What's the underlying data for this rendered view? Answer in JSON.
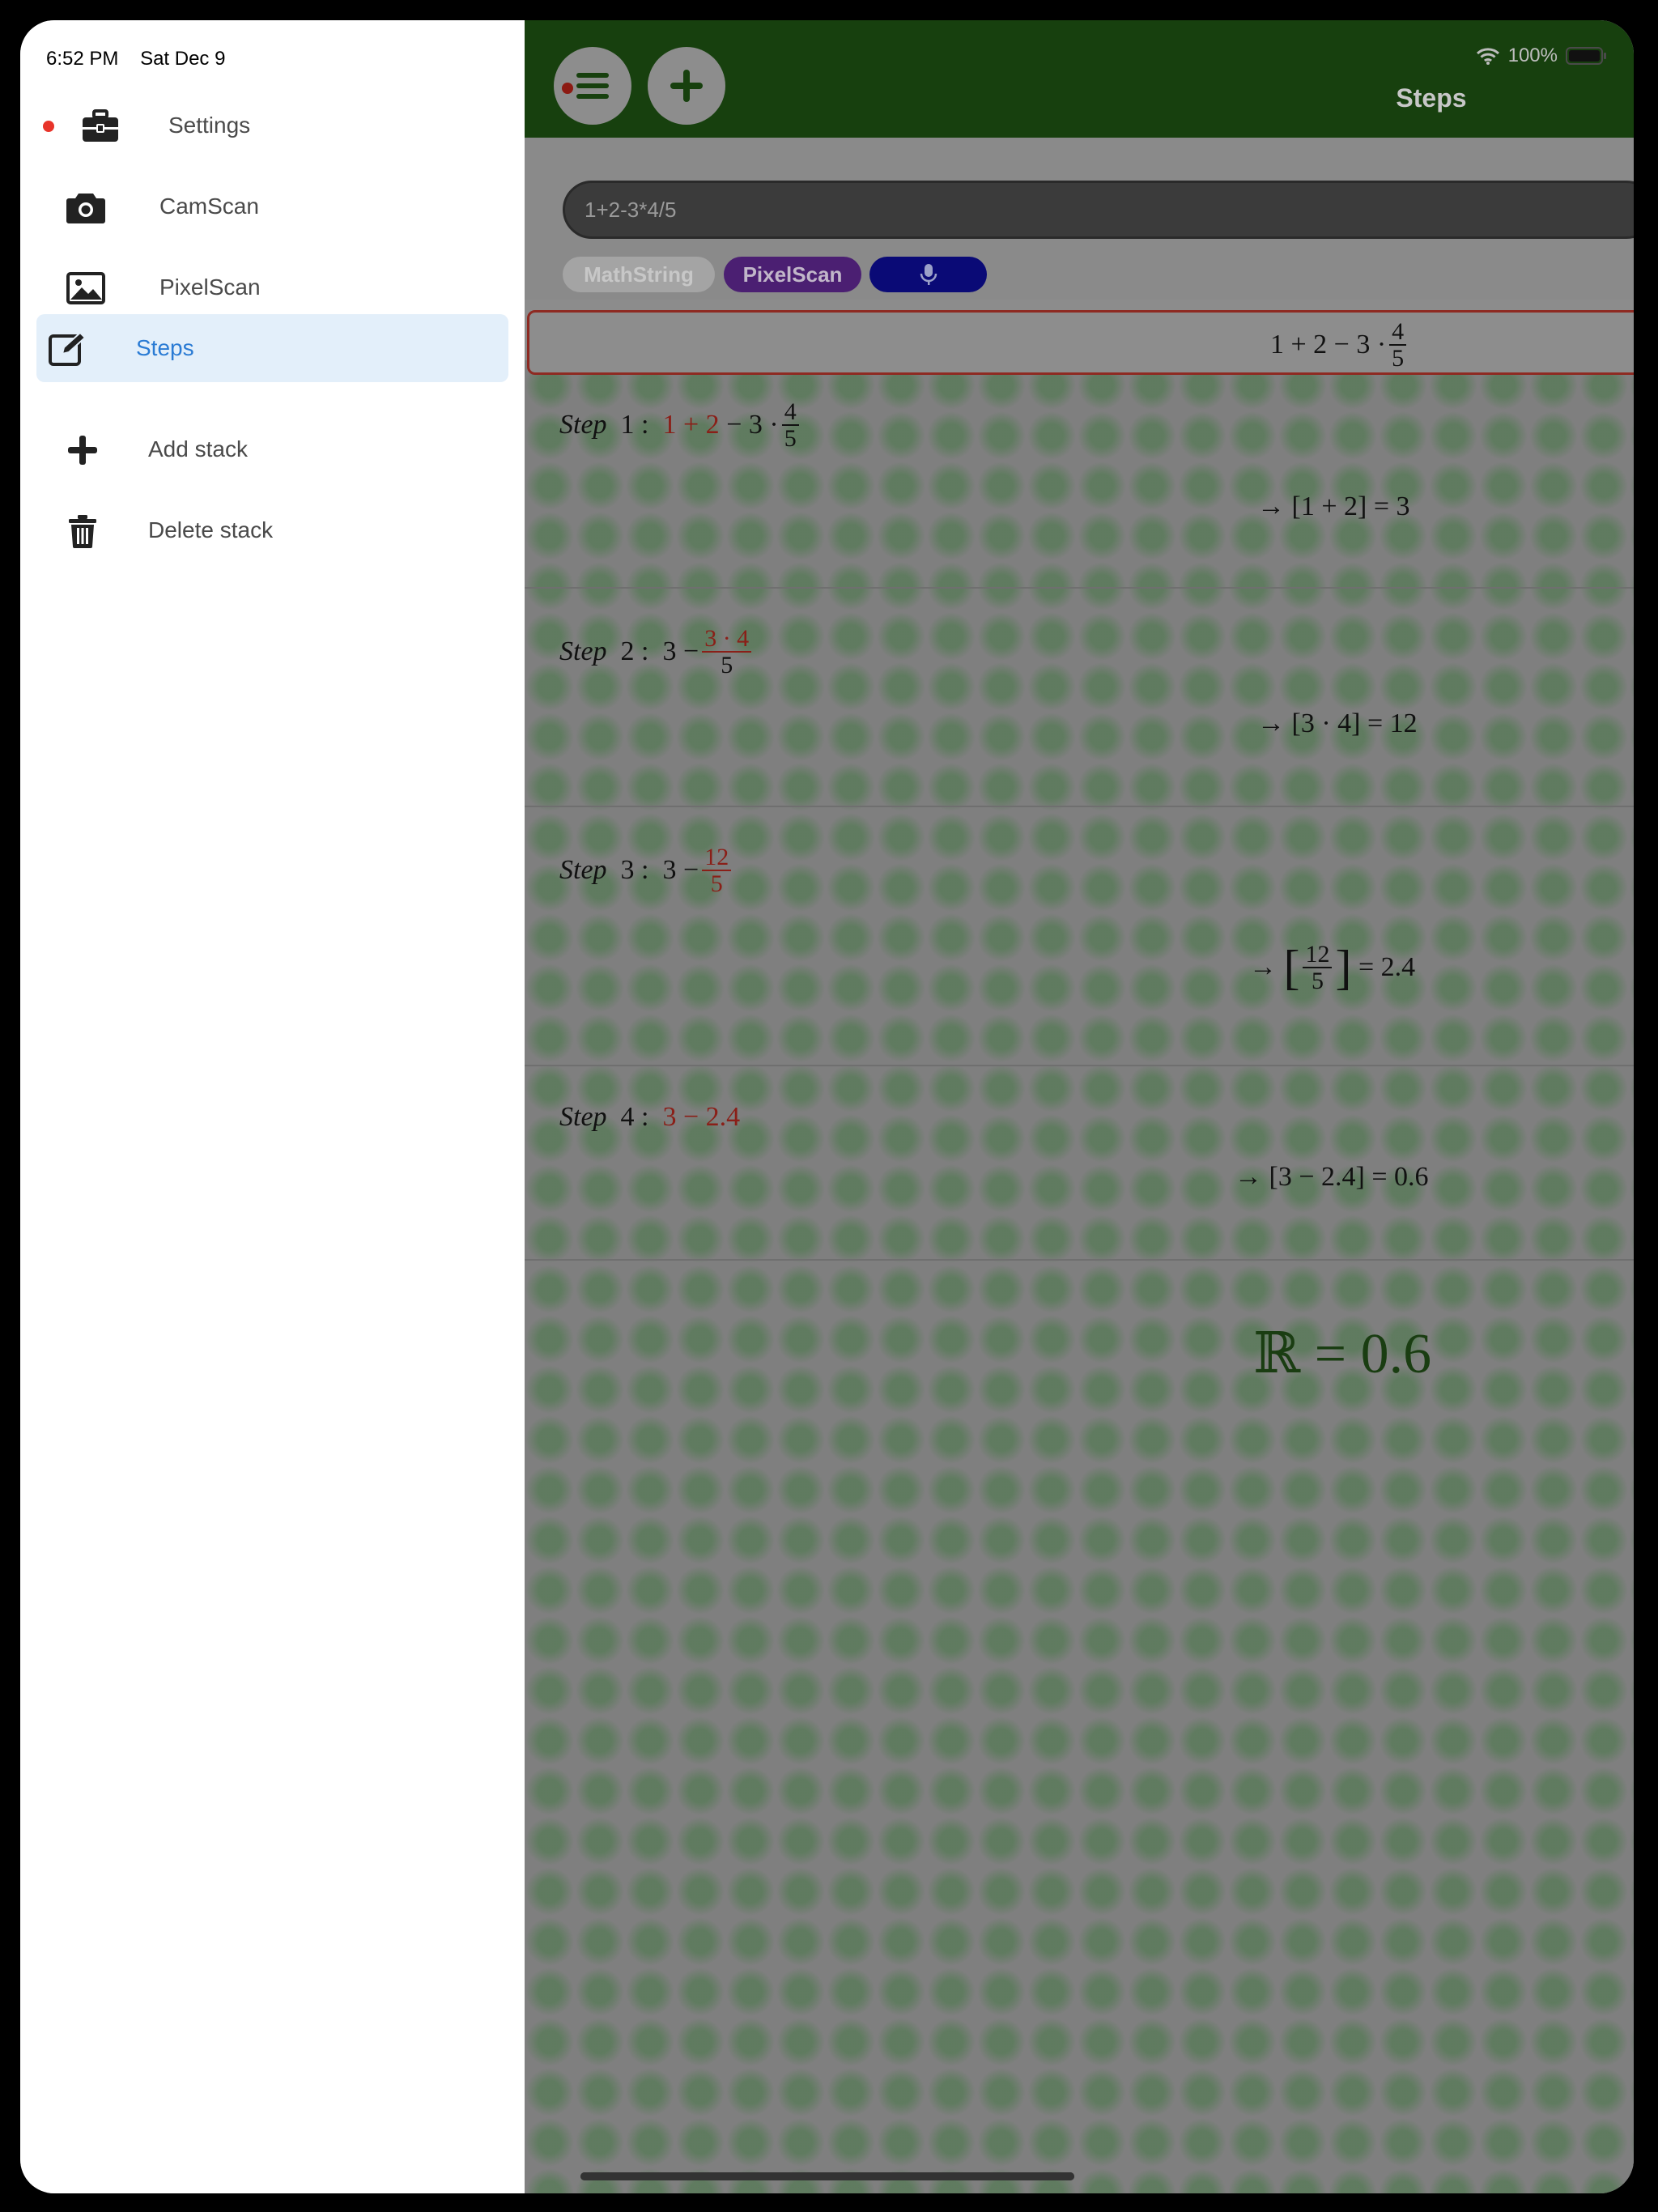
{
  "status_bar": {
    "time": "6:52 PM",
    "date": "Sat Dec 9",
    "battery": "100%"
  },
  "sidebar": {
    "items": [
      {
        "label": "Settings",
        "icon": "briefcase-icon",
        "has_notification": true
      },
      {
        "label": "CamScan",
        "icon": "camera-icon"
      },
      {
        "label": "PixelScan",
        "icon": "image-icon"
      },
      {
        "label": "Steps",
        "icon": "edit-icon",
        "active": true
      },
      {
        "label": "Add stack",
        "icon": "plus-icon"
      },
      {
        "label": "Delete stack",
        "icon": "trash-icon"
      }
    ]
  },
  "header": {
    "title": "Steps"
  },
  "input": {
    "value": "1+2-3*4/5"
  },
  "modes": {
    "mathstring": "MathString",
    "pixelscan": "PixelScan",
    "voice_icon": "microphone-icon"
  },
  "expression": {
    "a": "1 + 2 − 3 ·",
    "num": "4",
    "den": "5"
  },
  "steps": [
    {
      "word": "Step",
      "num": "1 :",
      "red": "1 + 2",
      "rest": "− 3 ·",
      "frac_num": "4",
      "frac_den": "5",
      "result": "→ [1 + 2] = 3"
    },
    {
      "word": "Step",
      "num": "2 :",
      "prefix": "3 −",
      "frac_num": "3 · 4",
      "frac_den": "5",
      "result": "→ [3 · 4] = 12"
    },
    {
      "word": "Step",
      "num": "3 :",
      "prefix": "3 −",
      "frac_num": "12",
      "frac_den": "5",
      "result_arrow": "→",
      "result_num": "12",
      "result_den": "5",
      "result_tail": "= 2.4"
    },
    {
      "word": "Step",
      "num": "4 :",
      "red": "3 − 2.4",
      "result": "→ [3 − 2.4] = 0.6"
    }
  ],
  "final": {
    "text": "ℝ = 0.6"
  },
  "colors": {
    "header_green": "#17400e",
    "highlight_red": "#8a1f18",
    "active_blue": "#2a7bd4",
    "notification_red": "#e8342a"
  }
}
